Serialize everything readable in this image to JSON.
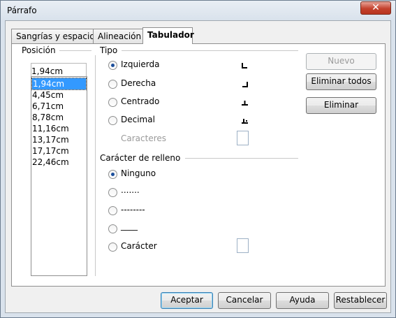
{
  "window": {
    "title": "Párrafo"
  },
  "tabs": [
    {
      "label": "Sangrías y espacios"
    },
    {
      "label": "Alineación"
    },
    {
      "label": "Tabulador"
    }
  ],
  "position": {
    "section_label": "Posición",
    "input_value": "1,94cm",
    "items": [
      "1,94cm",
      "4,45cm",
      "6,71cm",
      "8,78cm",
      "11,16cm",
      "13,17cm",
      "17,17cm",
      "22,46cm"
    ],
    "selected": "1,94cm"
  },
  "tipo": {
    "section_label": "Tipo",
    "options": [
      {
        "label": "Izquierda",
        "checked": true,
        "icon": "tab-left-icon"
      },
      {
        "label": "Derecha",
        "checked": false,
        "icon": "tab-right-icon"
      },
      {
        "label": "Centrado",
        "checked": false,
        "icon": "tab-center-icon"
      },
      {
        "label": "Decimal",
        "checked": false,
        "icon": "tab-decimal-icon"
      }
    ],
    "caracteres_label": "Caracteres"
  },
  "relleno": {
    "section_label": "Carácter de relleno",
    "options": [
      {
        "label": "Ninguno",
        "checked": true
      },
      {
        "label": ".......",
        "checked": false
      },
      {
        "label": "--------",
        "checked": false
      },
      {
        "label": "____",
        "checked": false
      },
      {
        "label": "Carácter",
        "checked": false
      }
    ]
  },
  "side_buttons": {
    "nuevo": "Nuevo",
    "eliminar_todos": "Eliminar todos",
    "eliminar": "Eliminar"
  },
  "footer": {
    "aceptar": "Aceptar",
    "cancelar": "Cancelar",
    "ayuda": "Ayuda",
    "restablecer": "Restablecer"
  },
  "colors": {
    "selection": "#3399ff",
    "radio_dot": "#1b4e9b",
    "close_button": "#c4412d"
  }
}
